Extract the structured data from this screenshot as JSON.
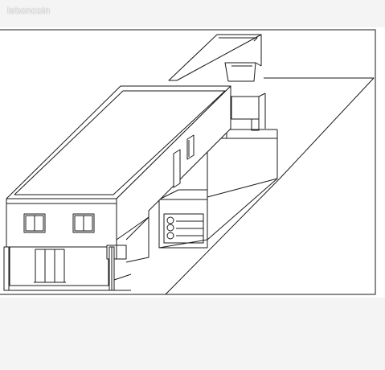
{
  "watermark": {
    "text": "leboncoin"
  },
  "colors": {
    "background": "#f4f4f4",
    "paper": "#ffffff",
    "line": "#1a1a1a",
    "watermark": "#ffffff"
  }
}
